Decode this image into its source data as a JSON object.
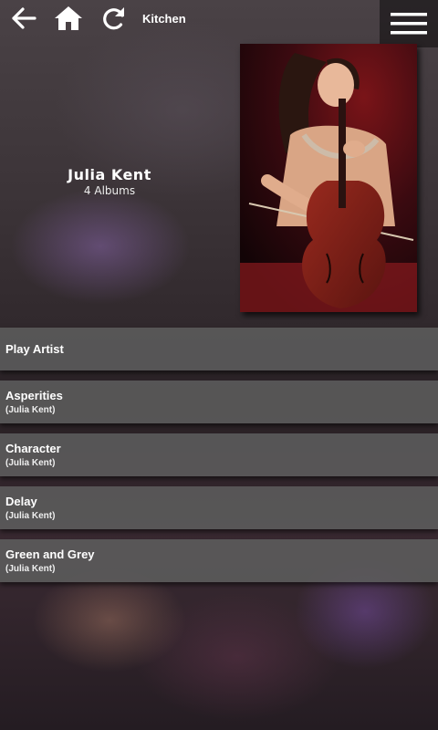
{
  "header": {
    "zone": "Kitchen",
    "icons": {
      "back": "back-arrow-icon",
      "home": "home-icon",
      "refresh": "refresh-icon",
      "menu": "hamburger-menu-icon"
    }
  },
  "artist": {
    "name": "Julia Kent",
    "album_count": "4 Albums",
    "photo": "artist-photo (cellist performing)"
  },
  "play_artist_label": "Play Artist",
  "albums": [
    {
      "title": "Asperities",
      "artist": "(Julia Kent)"
    },
    {
      "title": "Character",
      "artist": "(Julia Kent)"
    },
    {
      "title": "Delay",
      "artist": "(Julia Kent)"
    },
    {
      "title": "Green and Grey",
      "artist": "(Julia Kent)"
    }
  ],
  "colors": {
    "row_background": "#5c5c5c",
    "text": "#ffffff"
  }
}
